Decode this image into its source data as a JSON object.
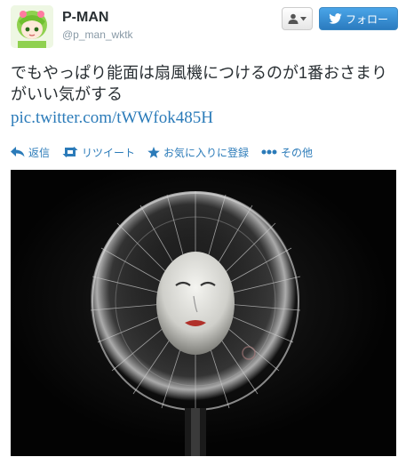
{
  "user": {
    "name": "P-MAN",
    "handle": "@p_man_wktk"
  },
  "buttons": {
    "follow_label": "フォロー"
  },
  "tweet": {
    "text": "でもやっぱり能面は扇風機につけるのが1番おさまりがいい気がする",
    "link": "pic.twitter.com/tWWfok485H"
  },
  "actions": {
    "reply": "返信",
    "retweet": "リツイート",
    "favorite": "お気に入りに登録",
    "more": "その他"
  },
  "colors": {
    "link": "#2b7bb9",
    "follow_button": "#2b7bbf",
    "background": "#ffffff"
  },
  "icons": {
    "user_menu": "user-dropdown-icon",
    "follow": "twitter-bird-icon",
    "reply": "reply-arrow-icon",
    "retweet": "retweet-icon",
    "favorite": "star-icon",
    "more": "ellipsis-icon"
  }
}
